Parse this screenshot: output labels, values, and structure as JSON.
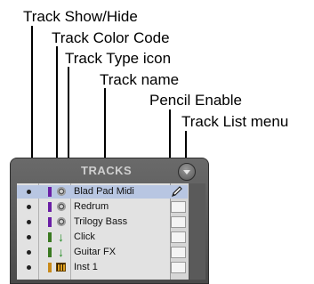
{
  "callouts": {
    "show_hide": "Track Show/Hide",
    "color_code": "Track Color Code",
    "type_icon": "Track Type icon",
    "name": "Track name",
    "pencil": "Pencil Enable",
    "list_menu": "Track List menu"
  },
  "panel": {
    "header": "TRACKS"
  },
  "tracks": [
    {
      "name": "Blad Pad Midi",
      "type": "aux-icon",
      "color": "#6a1fa6",
      "selected": true,
      "pencil": true
    },
    {
      "name": "Redrum",
      "type": "aux-icon",
      "color": "#6a1fa6",
      "selected": false,
      "pencil": false
    },
    {
      "name": "Trilogy Bass",
      "type": "aux-icon",
      "color": "#6a1fa6",
      "selected": false,
      "pencil": false
    },
    {
      "name": "Click",
      "type": "audio-arrow-icon",
      "color": "#3b7a22",
      "selected": false,
      "pencil": false
    },
    {
      "name": "Guitar FX",
      "type": "audio-arrow-icon",
      "color": "#3b7a22",
      "selected": false,
      "pencil": false
    },
    {
      "name": "Inst 1",
      "type": "instrument-keyboard-icon",
      "color": "#c98a1a",
      "selected": false,
      "pencil": false
    }
  ]
}
